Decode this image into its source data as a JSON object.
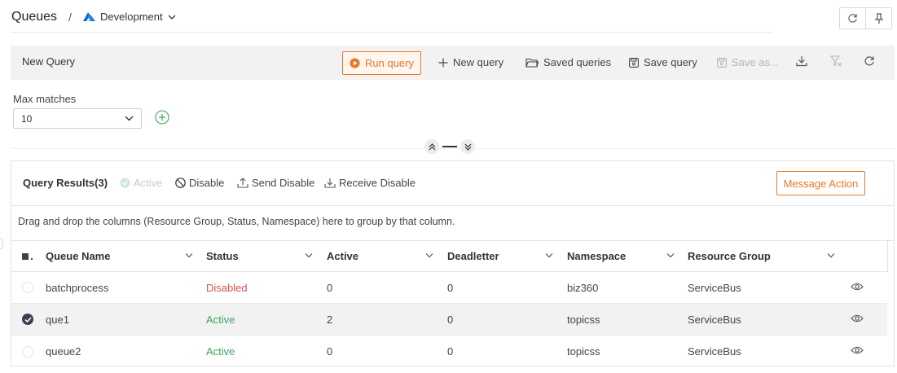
{
  "header": {
    "title": "Queues",
    "separator": "/",
    "environment": "Development",
    "environment_icon": "azure-logo"
  },
  "query_bar": {
    "title": "New Query",
    "run_label": "Run query",
    "new_label": "New query",
    "saved_label": "Saved queries",
    "save_label": "Save query",
    "save_as_label": "Save as..."
  },
  "max_matches": {
    "label": "Max matches",
    "value": "10"
  },
  "results": {
    "title": "Query Results(3)",
    "actions": {
      "active": "Active",
      "disable": "Disable",
      "send_disable": "Send Disable",
      "receive_disable": "Receive Disable"
    },
    "message_action": "Message Action",
    "group_hint": "Drag and drop the columns (Resource Group, Status, Namespace) here to group by that column.",
    "columns": [
      "Queue Name",
      "Status",
      "Active",
      "Deadletter",
      "Namespace",
      "Resource Group"
    ],
    "rows": [
      {
        "name": "batchprocess",
        "status": "Disabled",
        "active": "0",
        "deadletter": "0",
        "namespace": "biz360",
        "resource_group": "ServiceBus",
        "selected": false
      },
      {
        "name": "que1",
        "status": "Active",
        "active": "2",
        "deadletter": "0",
        "namespace": "topicss",
        "resource_group": "ServiceBus",
        "selected": true
      },
      {
        "name": "queue2",
        "status": "Active",
        "active": "0",
        "deadletter": "0",
        "namespace": "topicss",
        "resource_group": "ServiceBus",
        "selected": false
      }
    ]
  },
  "colors": {
    "accent": "#e8782a",
    "active": "#3aa55d",
    "disabled": "#d9534f",
    "azure": "#0a6ed1"
  }
}
